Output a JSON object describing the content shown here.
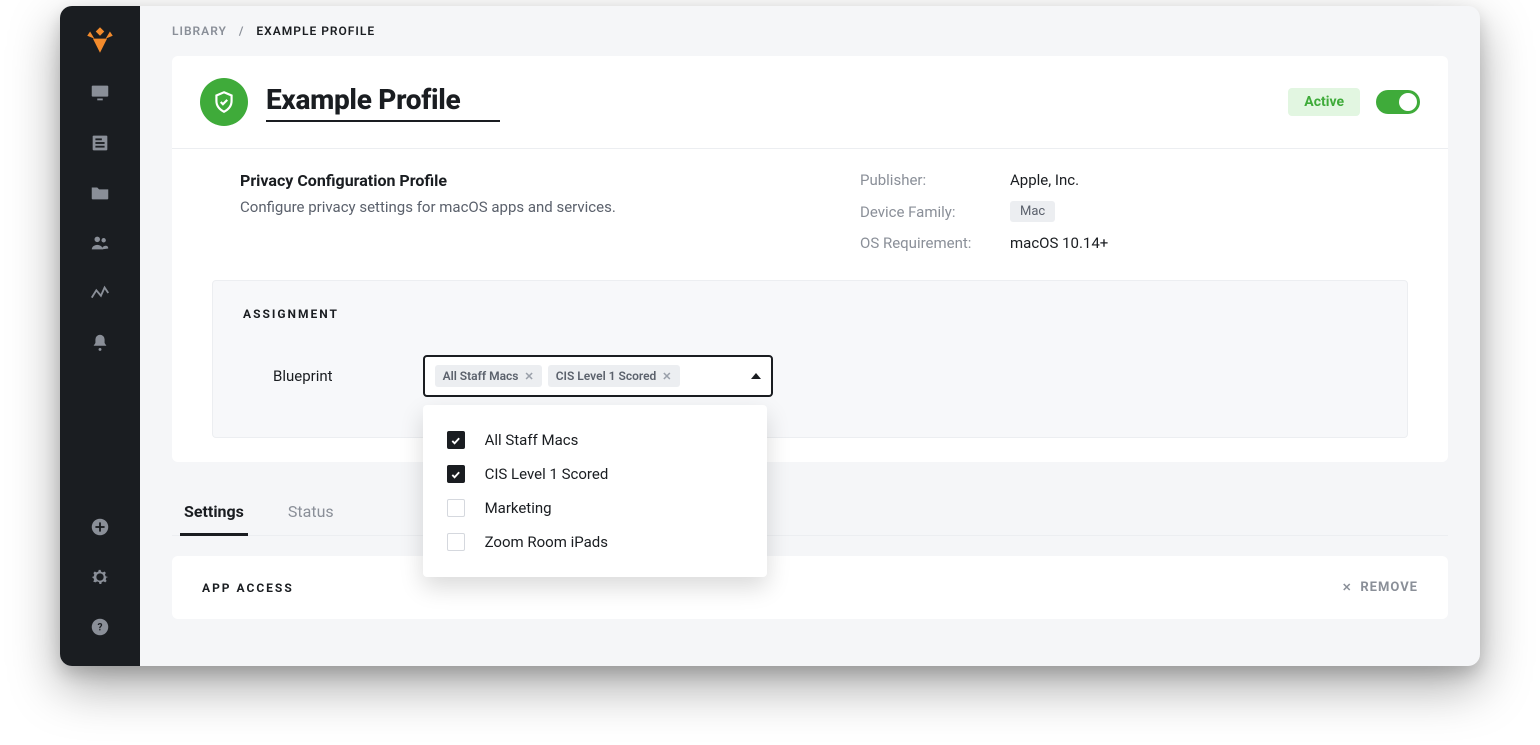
{
  "breadcrumb": {
    "root": "LIBRARY",
    "separator": "/",
    "current": "EXAMPLE PROFILE"
  },
  "header": {
    "title": "Example Profile",
    "status_label": "Active",
    "toggle_on": true
  },
  "summary": {
    "subtitle": "Privacy Configuration Profile",
    "description": "Configure privacy settings for macOS apps and services.",
    "publisher_label": "Publisher:",
    "publisher_value": "Apple, Inc.",
    "device_family_label": "Device Family:",
    "device_family_value": "Mac",
    "os_req_label": "OS Requirement:",
    "os_req_value": "macOS 10.14+"
  },
  "assignment": {
    "heading": "ASSIGNMENT",
    "field_label": "Blueprint",
    "selected": [
      {
        "label": "All Staff Macs"
      },
      {
        "label": "CIS Level 1 Scored"
      }
    ],
    "options": [
      {
        "label": "All Staff Macs",
        "checked": true
      },
      {
        "label": "CIS Level 1 Scored",
        "checked": true
      },
      {
        "label": "Marketing",
        "checked": false
      },
      {
        "label": "Zoom Room iPads",
        "checked": false
      }
    ]
  },
  "tabs": {
    "settings": "Settings",
    "status": "Status"
  },
  "app_access": {
    "heading": "APP ACCESS",
    "remove_label": "REMOVE"
  }
}
